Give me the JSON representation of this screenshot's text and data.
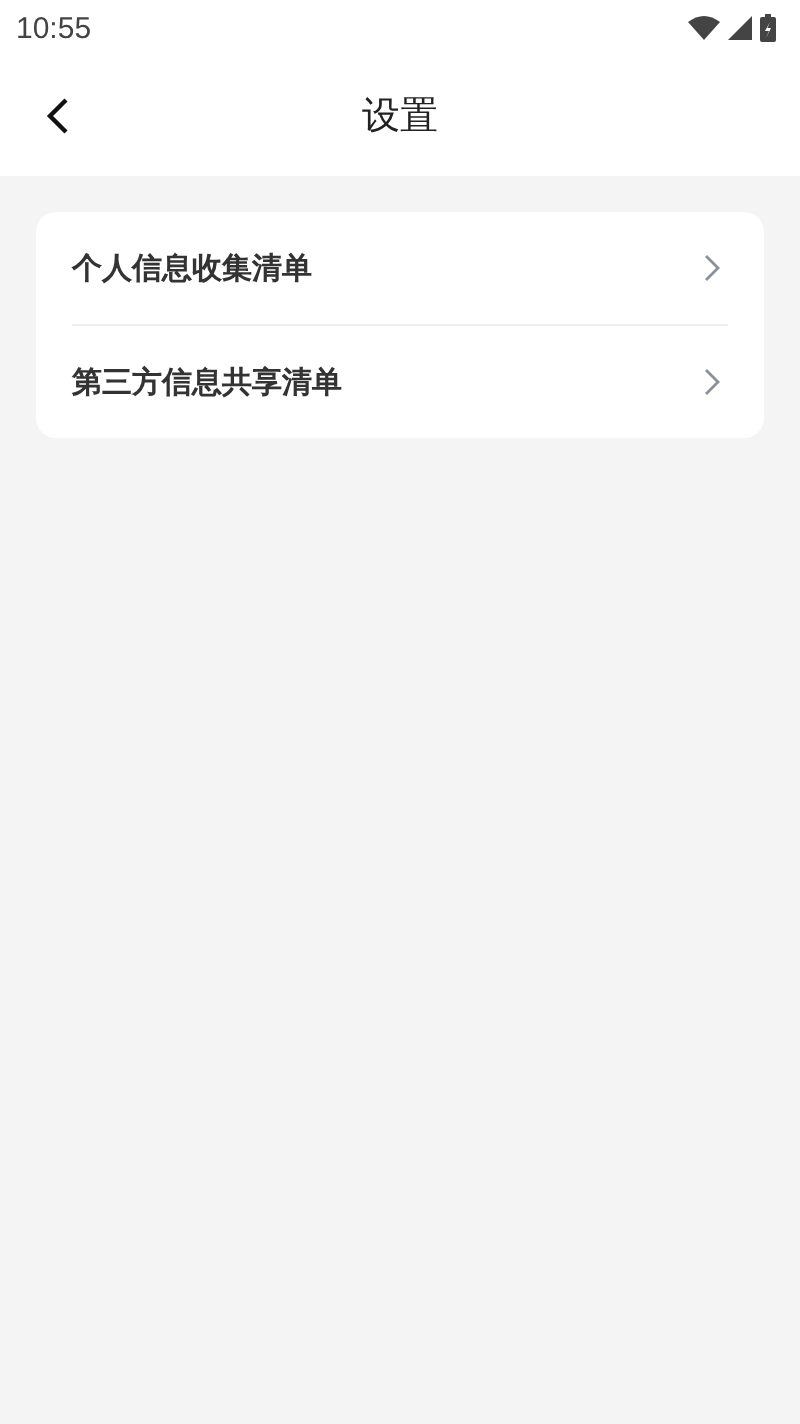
{
  "status_bar": {
    "time": "10:55"
  },
  "header": {
    "title": "设置"
  },
  "items": [
    {
      "label": "个人信息收集清单"
    },
    {
      "label": "第三方信息共享清单"
    }
  ]
}
